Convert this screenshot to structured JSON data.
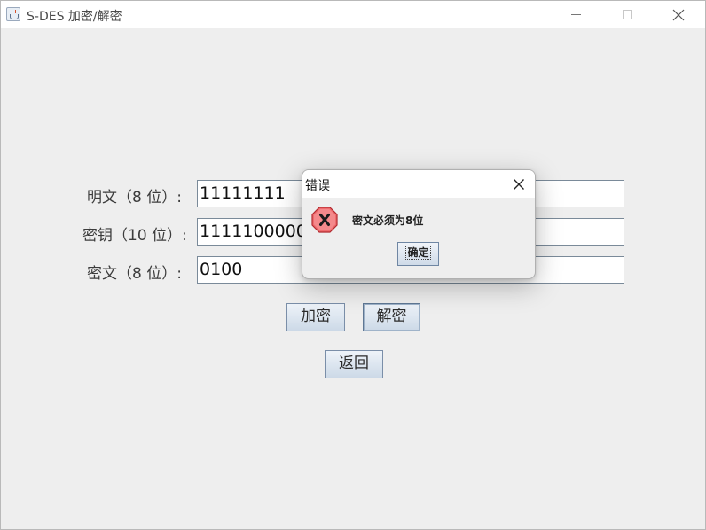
{
  "window": {
    "title": "S-DES 加密/解密",
    "icon": "java-cup-icon"
  },
  "form": {
    "plaintext_label": "明文（8 位）:",
    "plaintext_value": "11111111",
    "key_label": "密钥（10 位）:",
    "key_value": "1111100000",
    "ciphertext_label": "密文（8 位）:",
    "ciphertext_value": "0100"
  },
  "buttons": {
    "encrypt": "加密",
    "decrypt": "解密",
    "back": "返回"
  },
  "dialog": {
    "title": "错误",
    "message": "密文必须为8位",
    "ok": "确定",
    "icon": "error-icon"
  },
  "colors": {
    "error_red": "#e0393e",
    "button_border": "#7a8ea8"
  }
}
